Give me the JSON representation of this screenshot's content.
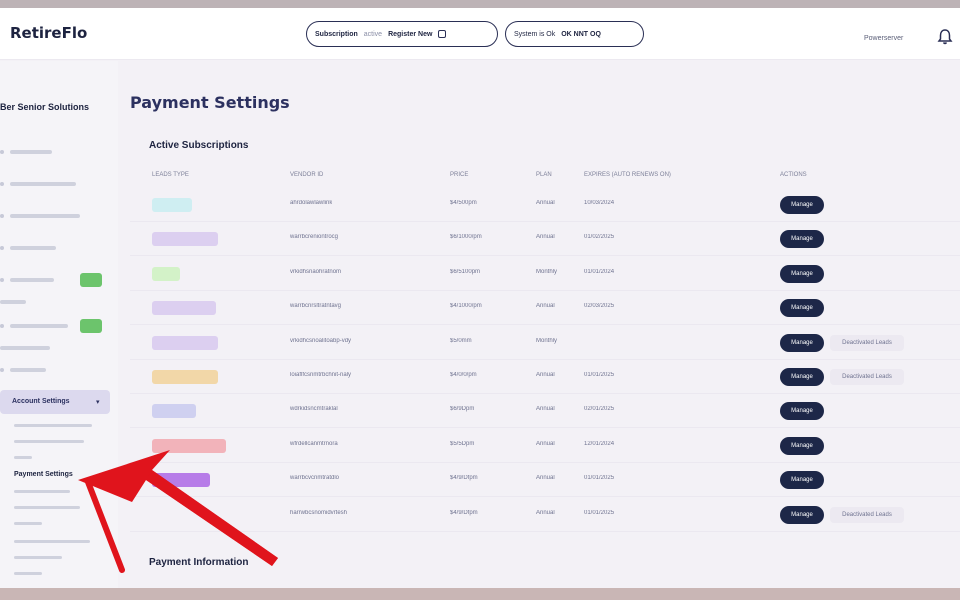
{
  "app": {
    "logo": "RetireFlo"
  },
  "header": {
    "pill1": {
      "label": "Subscription",
      "muted": "active",
      "strong": "Register New"
    },
    "pill2": {
      "label": "System is Ok",
      "strong": "OK  NNT  OQ"
    },
    "user": "Powerserver",
    "bell_icon": "bell-icon"
  },
  "sidebar": {
    "org": "Ber Senior Solutions",
    "active_item": "Account Settings",
    "current_sub": "Payment Settings"
  },
  "main": {
    "title": "Payment Settings",
    "active_subscriptions": "Active Subscriptions",
    "payment_information": "Payment Information",
    "columns": [
      "Leads Type",
      "Vendor ID",
      "Price",
      "Plan",
      "Expires (Auto Renews On)",
      "Actions"
    ]
  },
  "rows": [
    {
      "tag_color": "#cfeef2",
      "vendor": "ahrdolawlawlink",
      "price": "$4/500pm",
      "plan": "Annual",
      "expires": "10/03/2024",
      "manage": "Manage",
      "cancel": ""
    },
    {
      "tag_color": "#dccff0",
      "vendor": "warrbcreniontrocg",
      "price": "$6/1000/pm",
      "plan": "Annual",
      "expires": "01/02/2025",
      "manage": "Manage",
      "cancel": ""
    },
    {
      "tag_color": "#d3f2c8",
      "vendor": "vrkidhsnaohratnom",
      "price": "$6/5100pm",
      "plan": "Monthly",
      "expires": "01/01/2024",
      "manage": "Manage",
      "cancel": ""
    },
    {
      "tag_color": "#dccff0",
      "vendor": "warrbcnrsltratntavg",
      "price": "$4/1000/pm",
      "plan": "Annual",
      "expires": "02/03/2025",
      "manage": "Manage",
      "cancel": ""
    },
    {
      "tag_color": "#dccff0",
      "vendor": "vrkidhcsnoalitoabp-vdy",
      "price": "$5/0mm",
      "plan": "Monthly",
      "expires": "",
      "manage": "Manage",
      "cancel": "Deactivated Leads"
    },
    {
      "tag_color": "#f2d7a8",
      "vendor": "loiaflfcsnmtrbchnit-naly",
      "price": "$4/0/0/pm",
      "plan": "Annual",
      "expires": "01/01/2025",
      "manage": "Manage",
      "cancel": "Deactivated Leads"
    },
    {
      "tag_color": "#cfd0f0",
      "vendor": "wdrkidsncmtraklal",
      "price": "$6/9Dpm",
      "plan": "Annual",
      "expires": "02/01/2025",
      "manage": "Manage",
      "cancel": ""
    },
    {
      "tag_color": "#f2b3ba",
      "vendor": "wfrdellcanmtrnora",
      "price": "$5/5Dpm",
      "plan": "Annual",
      "expires": "12/01/2024",
      "manage": "Manage",
      "cancel": ""
    },
    {
      "tag_color": "#b77ce8",
      "vendor": "warrbcvcnmtratdlo",
      "price": "$4/9/Dfpm",
      "plan": "Annual",
      "expires": "01/01/2025",
      "manage": "Manage",
      "cancel": ""
    },
    {
      "tag_color": "",
      "vendor": "harrwbcsnomidvrtesh",
      "price": "$4/9/Dfpm",
      "plan": "Annual",
      "expires": "01/01/2025",
      "manage": "Manage",
      "cancel": "Deactivated Leads"
    }
  ],
  "colors": {
    "manage_button": "#1d2748",
    "annotation_arrow": "#e0141c",
    "active_nav": "#dcd9ee"
  }
}
